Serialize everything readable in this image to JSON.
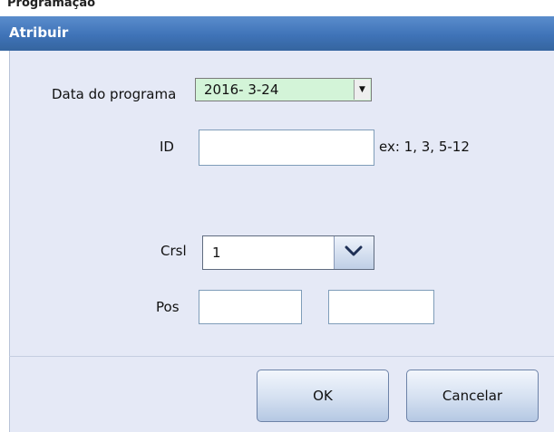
{
  "page_header": {
    "text": "Programação"
  },
  "dialog": {
    "title": "Atribuir",
    "date_label": "Data do programa",
    "date_value": "2016-  3-24",
    "id_label": "ID",
    "id_value": "",
    "id_hint": "ex: 1, 3, 5-12",
    "crsl_label": "Crsl",
    "crsl_value": "1",
    "pos_label": "Pos",
    "pos_value_1": "",
    "pos_value_2": "",
    "ok_label": "OK",
    "cancel_label": "Cancelar"
  },
  "colors": {
    "title_bar": "#3f73b8",
    "dialog_bg": "#e5e9f6",
    "date_field_bg": "#d3f4d8"
  }
}
